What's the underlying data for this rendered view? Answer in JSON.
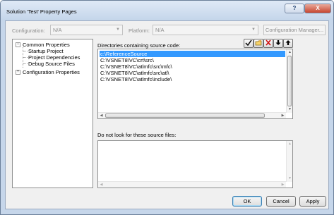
{
  "window": {
    "title": "Solution 'Test' Property Pages",
    "help_glyph": "?",
    "close_glyph": "X"
  },
  "config_bar": {
    "configuration_label": "Configuration:",
    "configuration_value": "N/A",
    "platform_label": "Platform:",
    "platform_value": "N/A",
    "manager_button": "Configuration Manager..."
  },
  "tree": {
    "items": [
      {
        "label": "Common Properties",
        "expander": "−"
      },
      {
        "label": "Startup Project"
      },
      {
        "label": "Project Dependencies"
      },
      {
        "label": "Debug Source Files"
      },
      {
        "label": "Configuration Properties",
        "expander": "+"
      }
    ]
  },
  "source_dirs": {
    "label": "Directories containing source code:",
    "toolbar": [
      "checkmark-icon",
      "new-folder-icon",
      "delete-icon",
      "move-down-icon",
      "move-up-icon"
    ],
    "items": [
      "c:\\ReferenceSource",
      "C:\\VSNET8\\VC\\crt\\src\\",
      "C:\\VSNET8\\VC\\atlmfc\\src\\mfc\\",
      "C:\\VSNET8\\VC\\atlmfc\\src\\atl\\",
      "C:\\VSNET8\\VC\\atlmfc\\include\\"
    ],
    "selected_index": 0
  },
  "exclude_files": {
    "label": "Do not look for these source files:",
    "items": []
  },
  "buttons": {
    "ok": "OK",
    "cancel": "Cancel",
    "apply": "Apply"
  },
  "colors": {
    "selection": "#3399ff",
    "frame": "#c6d6ea",
    "client": "#f0f0f0"
  }
}
